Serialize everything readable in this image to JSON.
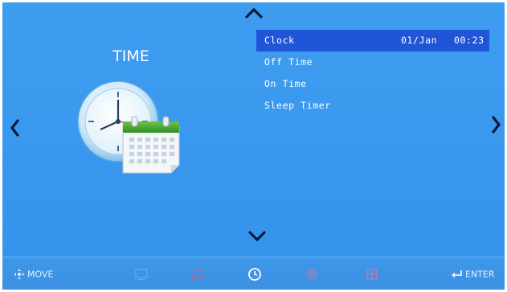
{
  "section": {
    "title": "TIME",
    "icon": "clock-calendar-icon"
  },
  "menu": {
    "items": [
      {
        "label": "Clock",
        "date": "01/Jan",
        "time": "00:23",
        "selected": true
      },
      {
        "label": "Off Time"
      },
      {
        "label": "On Time"
      },
      {
        "label": "Sleep Timer"
      }
    ]
  },
  "footer": {
    "move_label": "MOVE",
    "enter_label": "ENTER",
    "tabs": [
      {
        "icon": "picture-icon"
      },
      {
        "icon": "music-note-icon"
      },
      {
        "icon": "clock-icon",
        "active": true
      },
      {
        "icon": "gear-icon"
      },
      {
        "icon": "grid-icon"
      }
    ]
  },
  "colors": {
    "background": "#3a98ee",
    "highlight": "#1f55d6",
    "text": "#ffffff"
  }
}
